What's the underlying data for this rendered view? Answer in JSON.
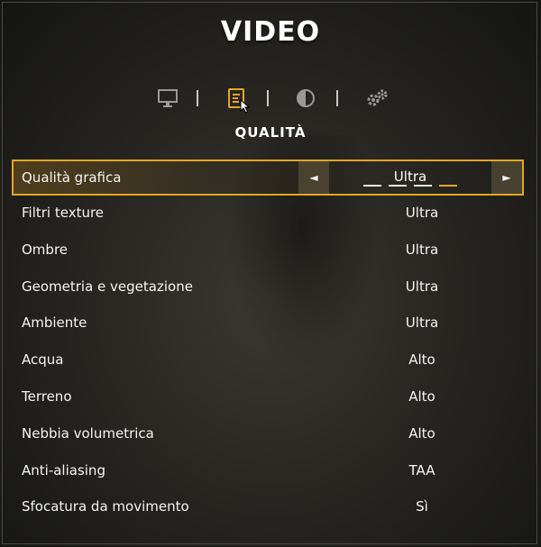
{
  "header": {
    "title": "VIDEO",
    "subtitle": "QUALITÀ"
  },
  "tabs": [
    {
      "icon": "monitor-icon",
      "active": false
    },
    {
      "icon": "quality-list-icon",
      "active": true
    },
    {
      "icon": "contrast-icon",
      "active": false
    },
    {
      "icon": "gears-icon",
      "active": false
    }
  ],
  "colors": {
    "accent": "#e3a62a",
    "text": "#f5f5f5",
    "inactive_icon": "#9a9a9a"
  },
  "settings": [
    {
      "label": "Qualità grafica",
      "value": "Ultra",
      "selected": true,
      "level": 4,
      "levels": 4
    },
    {
      "label": "Filtri texture",
      "value": "Ultra"
    },
    {
      "label": "Ombre",
      "value": "Ultra"
    },
    {
      "label": "Geometria e vegetazione",
      "value": "Ultra"
    },
    {
      "label": "Ambiente",
      "value": "Ultra"
    },
    {
      "label": "Acqua",
      "value": "Alto"
    },
    {
      "label": "Terreno",
      "value": "Alto"
    },
    {
      "label": "Nebbia volumetrica",
      "value": "Alto"
    },
    {
      "label": "Anti-aliasing",
      "value": "TAA"
    },
    {
      "label": "Sfocatura da movimento",
      "value": "Sì"
    }
  ],
  "arrows": {
    "left": "◄",
    "right": "►"
  }
}
